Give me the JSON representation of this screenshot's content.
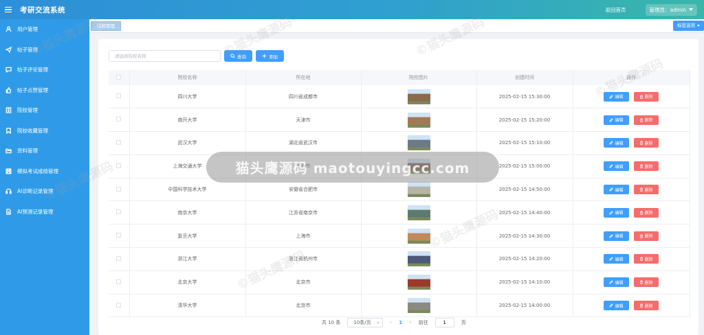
{
  "header": {
    "title": "考研交流系统",
    "back_home": "返回首页",
    "admin_label": "管理员：admin"
  },
  "sidebar": {
    "items": [
      {
        "label": "用户管理",
        "icon": "user-icon"
      },
      {
        "label": "帖子管理",
        "icon": "send-icon"
      },
      {
        "label": "帖子评论管理",
        "icon": "comment-icon"
      },
      {
        "label": "帖子点赞管理",
        "icon": "thumb-up-icon"
      },
      {
        "label": "院校管理",
        "icon": "building-icon"
      },
      {
        "label": "院校收藏管理",
        "icon": "bookmark-icon"
      },
      {
        "label": "资料管理",
        "icon": "folder-icon"
      },
      {
        "label": "模拟考试成绩管理",
        "icon": "save-icon"
      },
      {
        "label": "AI诊断记录管理",
        "icon": "headset-icon"
      },
      {
        "label": "AI预测记录管理",
        "icon": "document-icon"
      }
    ]
  },
  "tabs": {
    "active": "院校管理",
    "options": "标签选项"
  },
  "search": {
    "placeholder": "请选择院校名称",
    "query_label": "查询",
    "add_label": "添加"
  },
  "table": {
    "columns": [
      "院校名称",
      "所在地",
      "院校图片",
      "创建时间",
      "操作"
    ],
    "edit_label": "编辑",
    "delete_label": "删除",
    "rows": [
      {
        "name": "四川大学",
        "location": "四川省成都市",
        "time": "2025-02-15 15:30:00",
        "img_color": "#8a6a4a"
      },
      {
        "name": "南开大学",
        "location": "天津市",
        "time": "2025-02-15 15:20:00",
        "img_color": "#a57855"
      },
      {
        "name": "武汉大学",
        "location": "湖北省武汉市",
        "time": "2025-02-15 15:10:00",
        "img_color": "#6c7a88"
      },
      {
        "name": "上海交通大学",
        "location": "上海市",
        "time": "2025-02-15 15:00:00",
        "img_color": "#7a5a48"
      },
      {
        "name": "中国科学技术大学",
        "location": "安徽省合肥市",
        "time": "2025-02-15 14:50:00",
        "img_color": "#b8b4a8"
      },
      {
        "name": "南京大学",
        "location": "江苏省南京市",
        "time": "2025-02-15 14:40:00",
        "img_color": "#5d7a6e"
      },
      {
        "name": "复旦大学",
        "location": "上海市",
        "time": "2025-02-15 14:30:00",
        "img_color": "#c08a5a"
      },
      {
        "name": "浙江大学",
        "location": "浙江省杭州市",
        "time": "2025-02-15 14:20:00",
        "img_color": "#4a5a78"
      },
      {
        "name": "北京大学",
        "location": "北京市",
        "time": "2025-02-15 14:10:00",
        "img_color": "#9a3a2a"
      },
      {
        "name": "清华大学",
        "location": "北京市",
        "time": "2025-02-15 14:00:00",
        "img_color": "#8c8a80"
      }
    ]
  },
  "pagination": {
    "total": "共 10 条",
    "page_size": "10条/页",
    "current": "1",
    "goto": "前往",
    "goto_value": "1",
    "page_unit": "页"
  },
  "watermark": {
    "text": "猫头鹰源码 maotouyingcc.com"
  }
}
